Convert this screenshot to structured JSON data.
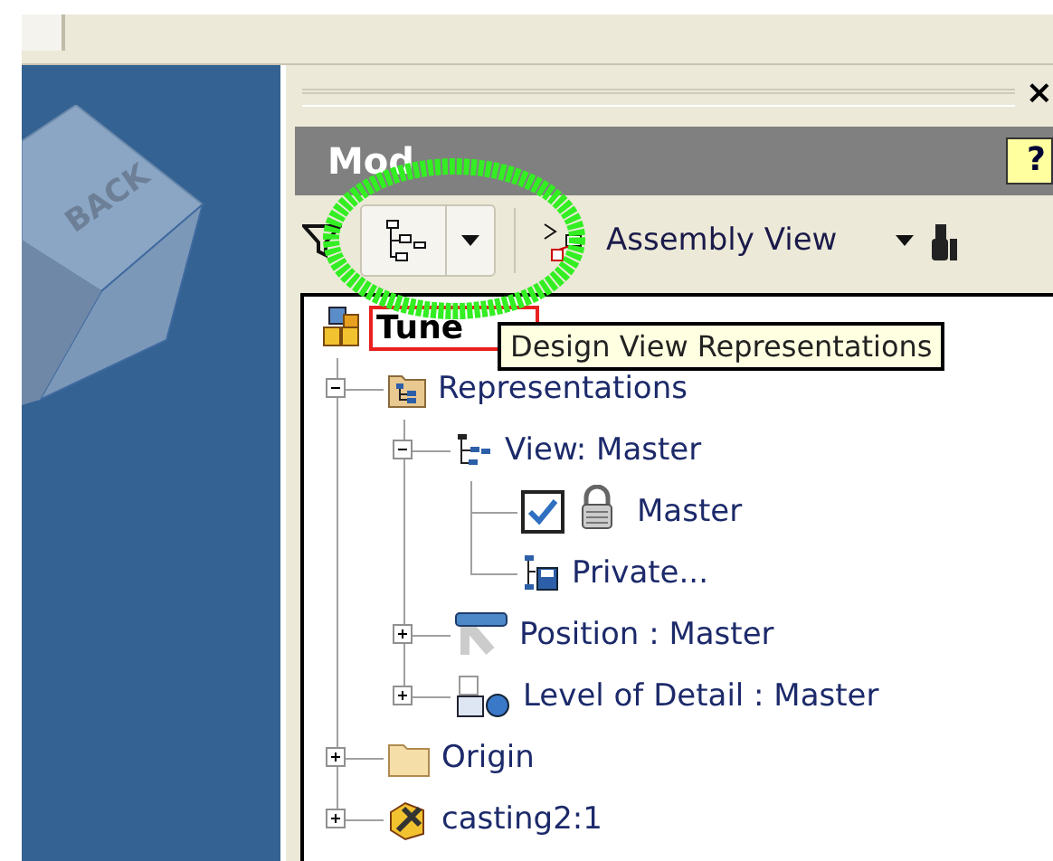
{
  "viewcube": {
    "face_label": "BACK"
  },
  "panel": {
    "close": "×",
    "title": "Mod",
    "help": "?"
  },
  "toolbar": {
    "view_dropdown": "Assembly View"
  },
  "tree": [
    {
      "label": "Tune",
      "kind": "assembly",
      "highlighted": true,
      "children": [
        {
          "label": "Representations",
          "kind": "representations",
          "expanded": true,
          "children": [
            {
              "label": "View: Master",
              "kind": "design-view",
              "expanded": true,
              "children": [
                {
                  "label": "Master",
                  "kind": "view-item",
                  "checked": true,
                  "locked": true
                },
                {
                  "label": "Private...",
                  "kind": "private-view"
                }
              ]
            },
            {
              "label": "Position : Master",
              "kind": "position",
              "expanded": false
            },
            {
              "label": "Level of Detail : Master",
              "kind": "level-of-detail",
              "expanded": false
            }
          ]
        },
        {
          "label": "Origin",
          "kind": "folder",
          "expanded": false
        },
        {
          "label": "casting2:1",
          "kind": "part",
          "expanded": false
        }
      ]
    }
  ],
  "tooltip": {
    "text": "Design View Representations"
  },
  "annotation": {
    "kind": "circle"
  }
}
